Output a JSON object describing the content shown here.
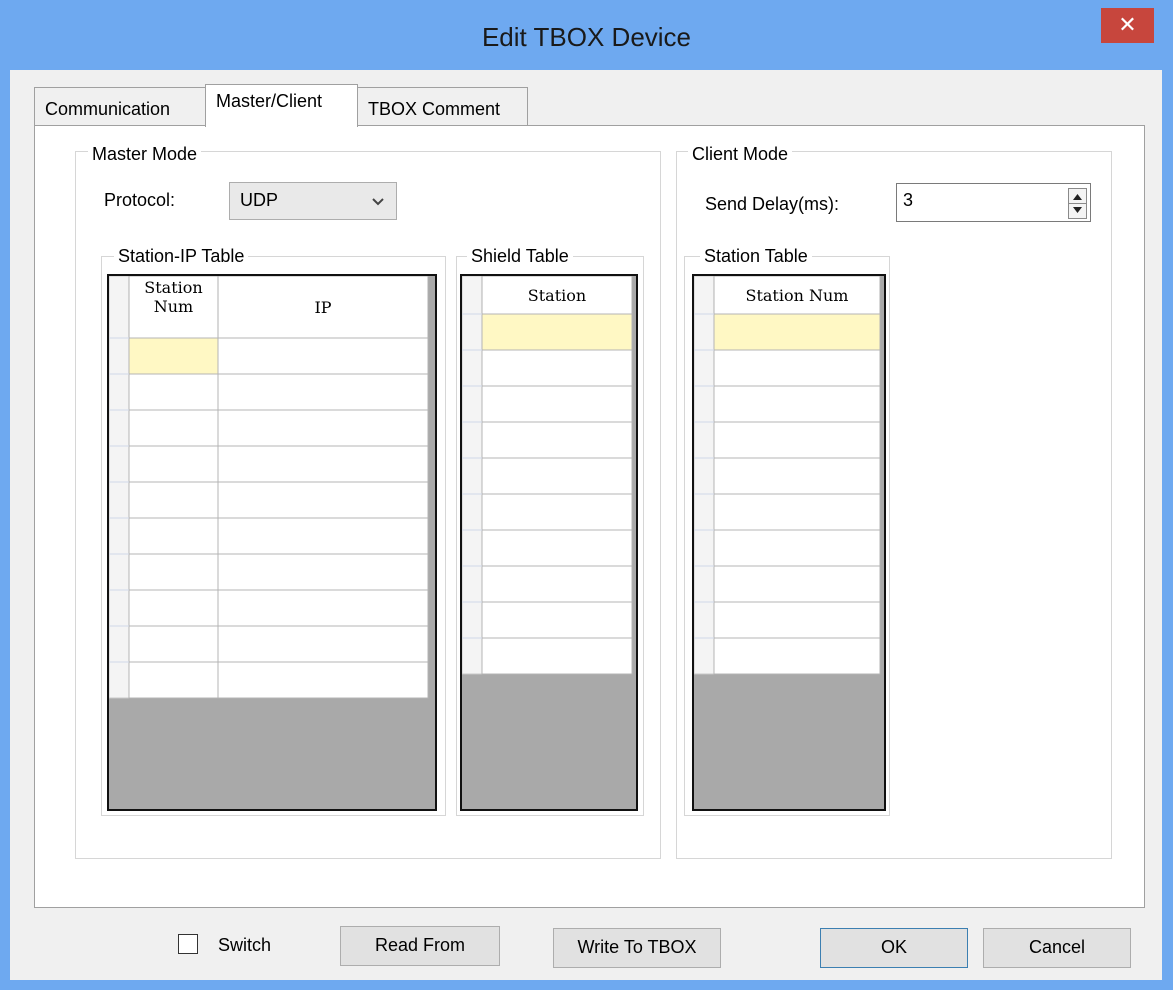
{
  "window": {
    "title": "Edit TBOX Device",
    "close_glyph": "✕"
  },
  "tabs": [
    {
      "label": "Communication"
    },
    {
      "label": "Master/Client"
    },
    {
      "label": "TBOX Comment"
    }
  ],
  "master_mode": {
    "group_label": "Master Mode",
    "protocol_label": "Protocol:",
    "protocol_value": "UDP",
    "station_ip_table": {
      "label": "Station-IP Table",
      "columns": [
        "Station\nNum",
        "IP"
      ],
      "row_count": 10,
      "rows": []
    },
    "shield_table": {
      "label": "Shield Table",
      "columns": [
        "Station"
      ],
      "row_count": 10,
      "rows": []
    }
  },
  "client_mode": {
    "group_label": "Client Mode",
    "send_delay_label": "Send Delay(ms):",
    "send_delay_value": "3",
    "station_table": {
      "label": "Station Table",
      "columns": [
        "Station Num"
      ],
      "row_count": 10,
      "rows": []
    }
  },
  "footer": {
    "switch_label": "Switch",
    "switch_checked": false,
    "read_from_label": "Read From",
    "write_to_tbox_label": "Write To TBOX",
    "ok_label": "OK",
    "cancel_label": "Cancel"
  },
  "colors": {
    "title_bar": "#6ea9f0",
    "close_button": "#c7463d",
    "selected_cell": "#fff8c4",
    "grid_empty_area": "#a9a9a9"
  }
}
